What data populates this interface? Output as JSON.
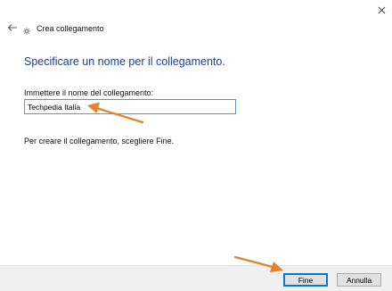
{
  "window": {
    "title": "Crea collegamento",
    "close_icon": "close-icon",
    "back_icon": "back-arrow-icon",
    "wizard_icon": "shortcut-wizard-icon"
  },
  "main": {
    "heading": "Specificare un nome per il collegamento.",
    "field_label": "Immettere il nome del collegamento:",
    "field_value": "Techpedia Italia",
    "instruction": "Per creare il collegamento, scegliere Fine."
  },
  "footer": {
    "finish_label": "Fine",
    "cancel_label": "Annulla"
  },
  "annotations": {
    "arrow_color": "#e8812a"
  }
}
